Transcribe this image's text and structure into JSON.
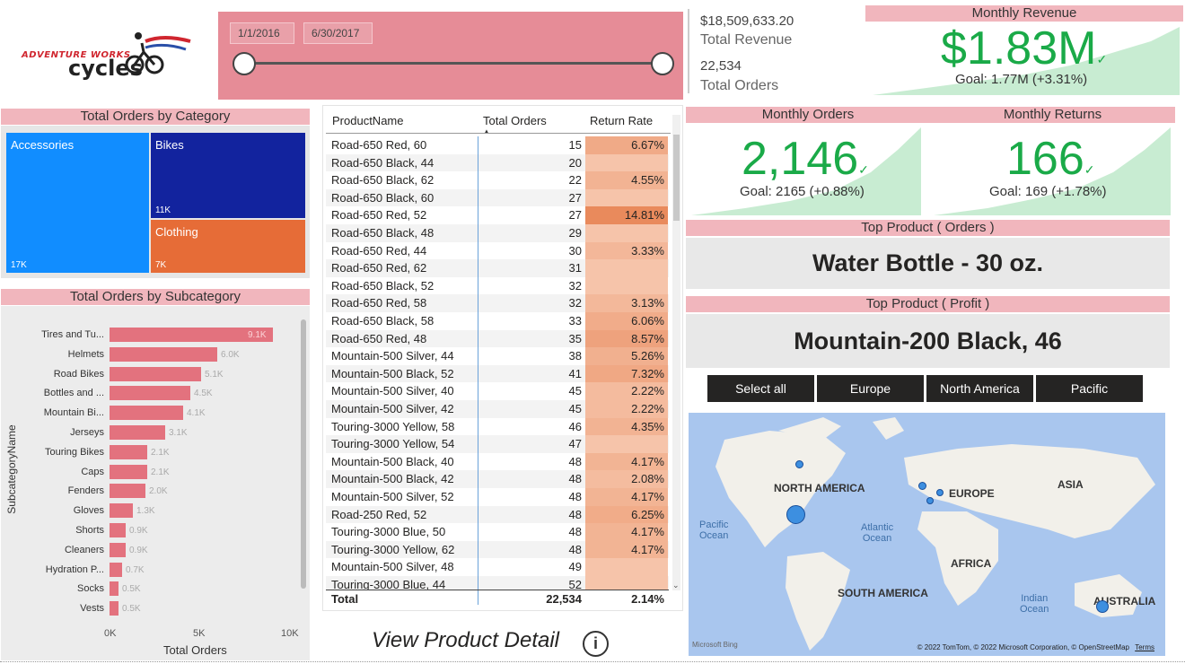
{
  "logo": {
    "line1": "ADVENTURE WORKS",
    "line2": "cycles"
  },
  "slicer": {
    "start_date": "1/1/2016",
    "end_date": "6/30/2017"
  },
  "totals": {
    "revenue_value": "$18,509,633.20",
    "revenue_label": "Total Revenue",
    "orders_value": "22,534",
    "orders_label": "Total Orders"
  },
  "monthly_revenue": {
    "title": "Monthly Revenue",
    "value": "$1.83M",
    "goal": "Goal: 1.77M (+3.31%)"
  },
  "monthly_orders": {
    "title": "Monthly Orders",
    "value": "2,146",
    "goal": "Goal: 2165 (+0.88%)"
  },
  "monthly_returns": {
    "title": "Monthly Returns",
    "value": "166",
    "goal": "Goal: 169 (+1.78%)"
  },
  "top_product_orders": {
    "title": "Top Product ( Orders )",
    "value": "Water Bottle - 30 oz."
  },
  "top_product_profit": {
    "title": "Top Product ( Profit )",
    "value": "Mountain-200 Black, 46"
  },
  "region_buttons": [
    "Select all",
    "Europe",
    "North America",
    "Pacific"
  ],
  "treemap": {
    "title": "Total Orders by Category",
    "items": [
      {
        "name": "Accessories",
        "value_label": "17K",
        "color": "#118dff"
      },
      {
        "name": "Bikes",
        "value_label": "11K",
        "color": "#12239e"
      },
      {
        "name": "Clothing",
        "value_label": "7K",
        "color": "#e66c37"
      }
    ]
  },
  "subcategory_chart": {
    "title": "Total Orders by Subcategory",
    "ylabel": "SubcategoryName",
    "xlabel": "Total Orders",
    "x_ticks": [
      "0K",
      "5K",
      "10K"
    ]
  },
  "chart_data": {
    "type": "bar",
    "title": "Total Orders by Subcategory",
    "xlabel": "Total Orders",
    "ylabel": "SubcategoryName",
    "xlim": [
      0,
      10000
    ],
    "categories": [
      "Tires and Tu...",
      "Helmets",
      "Road Bikes",
      "Bottles and ...",
      "Mountain Bi...",
      "Jerseys",
      "Touring Bikes",
      "Caps",
      "Fenders",
      "Gloves",
      "Shorts",
      "Cleaners",
      "Hydration P...",
      "Socks",
      "Vests"
    ],
    "values": [
      9100,
      6000,
      5100,
      4500,
      4100,
      3100,
      2100,
      2100,
      2000,
      1300,
      900,
      900,
      700,
      500,
      500
    ],
    "value_labels": [
      "9.1K",
      "6.0K",
      "5.1K",
      "4.5K",
      "4.1K",
      "3.1K",
      "2.1K",
      "2.1K",
      "2.0K",
      "1.3K",
      "0.9K",
      "0.9K",
      "0.7K",
      "0.5K",
      "0.5K"
    ]
  },
  "table": {
    "headers": [
      "ProductName",
      "Total Orders",
      "Return Rate"
    ],
    "rows": [
      [
        "Road-650 Red, 60",
        "15",
        "6.67%",
        0.45
      ],
      [
        "Road-650 Black, 44",
        "20",
        "",
        0.0
      ],
      [
        "Road-650 Black, 62",
        "22",
        "4.55%",
        0.3
      ],
      [
        "Road-650 Black, 60",
        "27",
        "",
        0.0
      ],
      [
        "Road-650 Red, 52",
        "27",
        "14.81%",
        1.0
      ],
      [
        "Road-650 Black, 48",
        "29",
        "",
        0.0
      ],
      [
        "Road-650 Red, 44",
        "30",
        "3.33%",
        0.22
      ],
      [
        "Road-650 Red, 62",
        "31",
        "",
        0.0
      ],
      [
        "Road-650 Black, 52",
        "32",
        "",
        0.0
      ],
      [
        "Road-650 Red, 58",
        "32",
        "3.13%",
        0.2
      ],
      [
        "Road-650 Black, 58",
        "33",
        "6.06%",
        0.41
      ],
      [
        "Road-650 Red, 48",
        "35",
        "8.57%",
        0.58
      ],
      [
        "Mountain-500 Silver, 44",
        "38",
        "5.26%",
        0.35
      ],
      [
        "Mountain-500 Black, 52",
        "41",
        "7.32%",
        0.49
      ],
      [
        "Mountain-500 Silver, 40",
        "45",
        "2.22%",
        0.15
      ],
      [
        "Mountain-500 Silver, 42",
        "45",
        "2.22%",
        0.15
      ],
      [
        "Touring-3000 Yellow, 58",
        "46",
        "4.35%",
        0.29
      ],
      [
        "Touring-3000 Yellow, 54",
        "47",
        "",
        0.0
      ],
      [
        "Mountain-500 Black, 40",
        "48",
        "4.17%",
        0.28
      ],
      [
        "Mountain-500 Black, 42",
        "48",
        "2.08%",
        0.14
      ],
      [
        "Mountain-500 Silver, 52",
        "48",
        "4.17%",
        0.28
      ],
      [
        "Road-250 Red, 52",
        "48",
        "6.25%",
        0.42
      ],
      [
        "Touring-3000 Blue, 50",
        "48",
        "4.17%",
        0.28
      ],
      [
        "Touring-3000 Yellow, 62",
        "48",
        "4.17%",
        0.28
      ],
      [
        "Mountain-500 Silver, 48",
        "49",
        "",
        0.0
      ],
      [
        "Touring-3000 Blue, 44",
        "52",
        "",
        0.0
      ]
    ],
    "total_label": "Total",
    "total_orders": "22,534",
    "total_rate": "2.14%"
  },
  "view_detail": {
    "label": "View Product Detail",
    "info_icon": "info-icon"
  },
  "map": {
    "continents": [
      "NORTH AMERICA",
      "EUROPE",
      "ASIA",
      "AFRICA",
      "SOUTH AMERICA",
      "AUSTRALIA"
    ],
    "oceans": [
      "Pacific\nOcean",
      "Atlantic\nOcean",
      "Indian\nOcean"
    ],
    "attribution": "© 2022 TomTom, © 2022 Microsoft Corporation, © OpenStreetMap",
    "terms": "Terms",
    "bing": "Microsoft Bing"
  }
}
